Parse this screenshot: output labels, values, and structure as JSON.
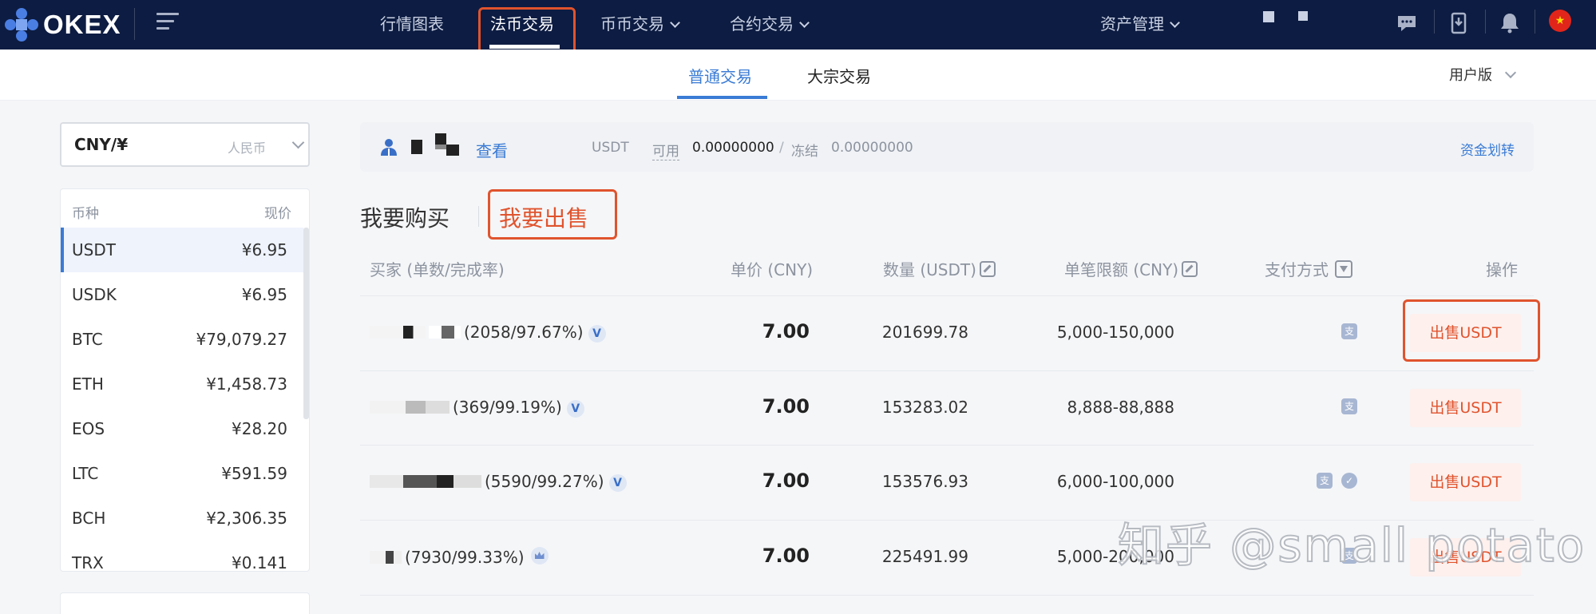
{
  "brand": {
    "logo_text": "OKEX"
  },
  "topnav": {
    "items": [
      {
        "label": "行情图表"
      },
      {
        "label": "法币交易"
      },
      {
        "label": "币币交易"
      },
      {
        "label": "合约交易"
      }
    ],
    "asset_mgmt": "资产管理"
  },
  "subnav": {
    "tabs": [
      {
        "label": "普通交易"
      },
      {
        "label": "大宗交易"
      }
    ],
    "user_version": "用户版"
  },
  "sidebar": {
    "currency": {
      "code": "CNY/¥",
      "name": "人民币"
    },
    "columns": {
      "coin": "币种",
      "price": "现价"
    },
    "coins": [
      {
        "name": "USDT",
        "price": "¥6.95"
      },
      {
        "name": "USDK",
        "price": "¥6.95"
      },
      {
        "name": "BTC",
        "price": "¥79,079.27"
      },
      {
        "name": "ETH",
        "price": "¥1,458.73"
      },
      {
        "name": "EOS",
        "price": "¥28.20"
      },
      {
        "name": "LTC",
        "price": "¥591.59"
      },
      {
        "name": "BCH",
        "price": "¥2,306.35"
      },
      {
        "name": "TRX",
        "price": "¥0.141"
      }
    ]
  },
  "account": {
    "view_label": "查看",
    "asset": "USDT",
    "available_label": "可用",
    "available_value": "0.00000000",
    "separator": "/",
    "frozen_label": "冻结",
    "frozen_value": "0.00000000",
    "transfer_label": "资金划转"
  },
  "trade_tabs": {
    "buy": "我要购买",
    "sell": "我要出售"
  },
  "table": {
    "headers": {
      "buyer": "买家 (单数/完成率)",
      "price": "单价 (CNY)",
      "quantity": "数量 (USDT)",
      "limit": "单笔限额 (CNY)",
      "payment": "支付方式",
      "action": "操作"
    },
    "rows": [
      {
        "stats": "(2058/97.67%)",
        "badge": "V",
        "price": "7.00",
        "quantity": "201699.78",
        "limit": "5,000-150,000",
        "action": "出售USDT"
      },
      {
        "stats": "(369/99.19%)",
        "badge": "V",
        "price": "7.00",
        "quantity": "153283.02",
        "limit": "8,888-88,888",
        "action": "出售USDT"
      },
      {
        "stats": "(5590/99.27%)",
        "badge": "V",
        "price": "7.00",
        "quantity": "153576.93",
        "limit": "6,000-100,000",
        "action": "出售USDT"
      },
      {
        "stats": "(7930/99.33%)",
        "badge": "",
        "price": "7.00",
        "quantity": "225491.99",
        "limit": "5,000-200,000",
        "action": "出售USDT"
      }
    ]
  },
  "watermark": "知乎 @small potato",
  "colors": {
    "nav_bg": "#0d1c42",
    "accent_blue": "#3a7bd5",
    "sell_red": "#e0542e",
    "annotation": "#e0542e"
  }
}
